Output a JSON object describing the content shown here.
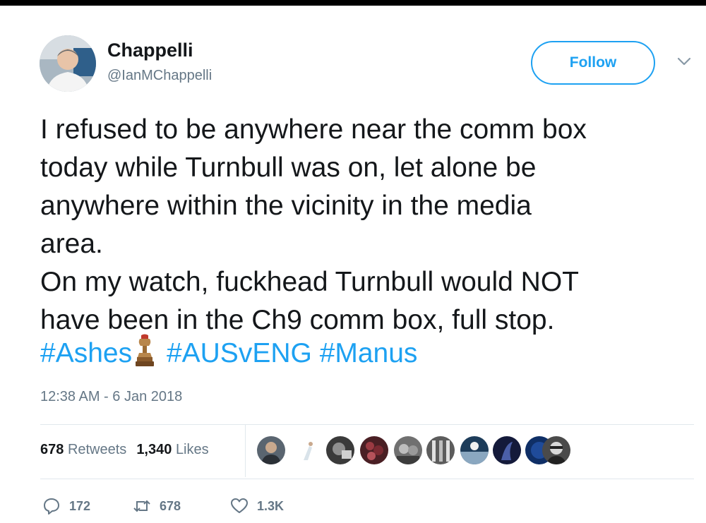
{
  "user": {
    "display_name": "Chappelli",
    "handle": "@IanMChappelli",
    "avatar_icon": "profile-photo"
  },
  "follow_button": {
    "label": "Follow"
  },
  "menu": {
    "icon": "chevron-down-icon"
  },
  "tweet": {
    "text": "I refused to be anywhere near the comm box\ntoday while Turnbull was on, let alone be\nanywhere within the vicinity in the media\narea.\nOn my watch, fuckhead Turnbull would NOT\nhave been in the Ch9 comm box, full stop.",
    "hashtags": [
      "#Ashes",
      "#AUSvENG",
      "#Manus"
    ],
    "hashtag_emoji": "ashes-urn-icon",
    "timestamp": "12:38 AM - 6 Jan 2018"
  },
  "stats": {
    "retweets_count": "678",
    "retweets_label": "Retweets",
    "likes_count": "1,340",
    "likes_label": "Likes"
  },
  "likers": [
    "liker-avatar-1",
    "liker-avatar-2",
    "liker-avatar-3",
    "liker-avatar-4",
    "liker-avatar-5",
    "liker-avatar-6",
    "liker-avatar-7",
    "liker-avatar-8",
    "liker-avatar-9",
    "liker-avatar-10"
  ],
  "actions": {
    "replies": "172",
    "retweets": "678",
    "likes": "1.3K"
  },
  "colors": {
    "accent": "#1da1f2",
    "text": "#14171a",
    "muted": "#657786",
    "divider": "#e1e8ed"
  }
}
